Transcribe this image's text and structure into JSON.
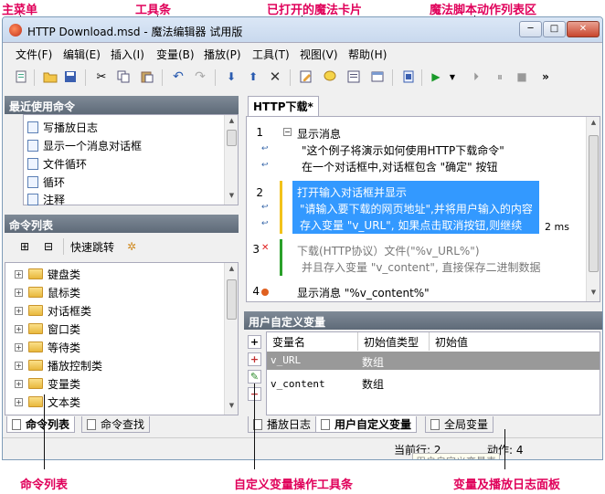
{
  "annotations": {
    "main_menu": "主菜单",
    "toolbar": "工具条",
    "open_cards": "已打开的魔法卡片",
    "action_list": "魔法脚本动作列表区",
    "command_list": "命令列表",
    "var_toolbar": "自定义变量操作工具条",
    "var_log_panel": "变量及播放日志面板"
  },
  "window": {
    "title": "HTTP Download.msd - 魔法编辑器 试用版",
    "min": "─",
    "max": "□",
    "close": "✕"
  },
  "menu": [
    "文件(F)",
    "编辑(E)",
    "插入(I)",
    "变量(B)",
    "播放(P)",
    "工具(T)",
    "视图(V)",
    "帮助(H)"
  ],
  "toolbar_icons": [
    "new-icon",
    "open-icon",
    "save-icon",
    "cut-icon",
    "copy-icon",
    "paste-icon",
    "undo-icon",
    "redo-icon",
    "move-down-icon",
    "move-up-icon",
    "delete-icon",
    "edit-icon",
    "comment-icon",
    "properties-icon",
    "panel-icon",
    "script-icon",
    "play-icon",
    "dropdown-icon",
    "step-icon",
    "pause-icon",
    "stop-icon",
    "more-icon"
  ],
  "recent": {
    "header": "最近使用命令",
    "items": [
      "写播放日志",
      "显示一个消息对话框",
      "文件循环",
      "循环",
      "注释"
    ]
  },
  "cmdlist": {
    "header": "命令列表",
    "quick_jump": "快速跳转",
    "items": [
      "键盘类",
      "鼠标类",
      "对话框类",
      "窗口类",
      "等待类",
      "播放控制类",
      "变量类",
      "文本类"
    ]
  },
  "left_tabs": [
    "命令列表",
    "命令查找"
  ],
  "editor": {
    "tab": "HTTP下载*",
    "lines": [
      {
        "num": "1",
        "text": "显示消息"
      },
      {
        "num": "",
        "text": "\"这个例子将演示如何使用HTTP下载命令\""
      },
      {
        "num": "",
        "text": "在一个对话框中,对话框包含 \"确定\" 按钮"
      },
      {
        "num": "2",
        "text": "打开输入对话框并显示"
      },
      {
        "num": "",
        "text": "\"请输入要下载的网页地址\",并将用户输入的内容"
      },
      {
        "num": "",
        "text": "存入变量 \"v_URL\", 如果点击取消按钮,则继续"
      },
      {
        "num": "3",
        "text": "下载(HTTP协议）文件(\"%v_URL%\")"
      },
      {
        "num": "",
        "text": "并且存入变量 \"v_content\", 直接保存二进制数据"
      },
      {
        "num": "4",
        "text": "显示消息 \"%v_content%\""
      }
    ],
    "timing": "2 ms",
    "error_mark": "✕"
  },
  "variables": {
    "header": "用户自定义变量",
    "columns": [
      "变量名",
      "初始值类型",
      "初始值"
    ],
    "rows": [
      {
        "name": "v_URL",
        "type": "数组"
      },
      {
        "name": "v_content",
        "type": "数组"
      }
    ],
    "side_buttons": [
      "+",
      "+",
      "✎",
      "−"
    ]
  },
  "right_tabs": [
    "播放日志",
    "用户自定义变量",
    "全局变量"
  ],
  "status": {
    "line": "当前行: 2",
    "action": "动作: 4",
    "tooltip": "用户自定义变量表"
  },
  "colors": {
    "selection": "#3399ff",
    "annotation": "#e0005a",
    "panel_header": "#6b7785"
  }
}
